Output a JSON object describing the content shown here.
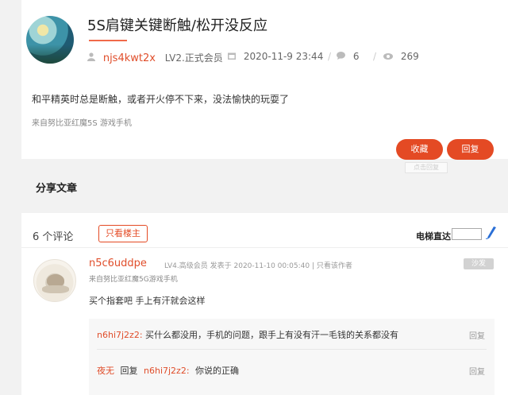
{
  "post": {
    "title": "5S肩键关键断触/松开没反应",
    "author": "njs4kwt2x",
    "level": "LV2.正式会员",
    "datetime": "2020-11-9 23:44",
    "comment_count": "6",
    "view_count": "269",
    "body": "和平精英时总是断触，或者开火停不下来，没法愉快的玩耍了",
    "from": "来自努比亚红魔5S 游戏手机",
    "favorite_label": "收藏",
    "reply_label": "回复",
    "ghost_tip": "点击回复"
  },
  "share": {
    "heading": "分享文章"
  },
  "comments": {
    "count_label": "6 个评论",
    "only_owner_label": "只看楼主",
    "elevator_label": "电梯直达",
    "floor_placeholder": "",
    "first": {
      "username": "n5c6uddpe",
      "meta": "LV4.高级会员  发表于 2020-11-10 00:05:40  |  只看该作者",
      "from": "来自努比亚红魔5G游戏手机",
      "badge": "沙发",
      "text": "买个指套吧  手上有汗就会这样",
      "replies": [
        {
          "name": "n6hi7j2z2:",
          "text": "买什么都没用，手机的问题，跟手上有没有汗一毛钱的关系都没有",
          "action": "回复"
        },
        {
          "name": "夜无",
          "mid": "回复",
          "target": "n6hi7j2z2:",
          "text": "你说的正确",
          "action": "回复"
        }
      ]
    }
  },
  "colors": {
    "accent": "#e44a24",
    "name": "#e04e2b"
  }
}
